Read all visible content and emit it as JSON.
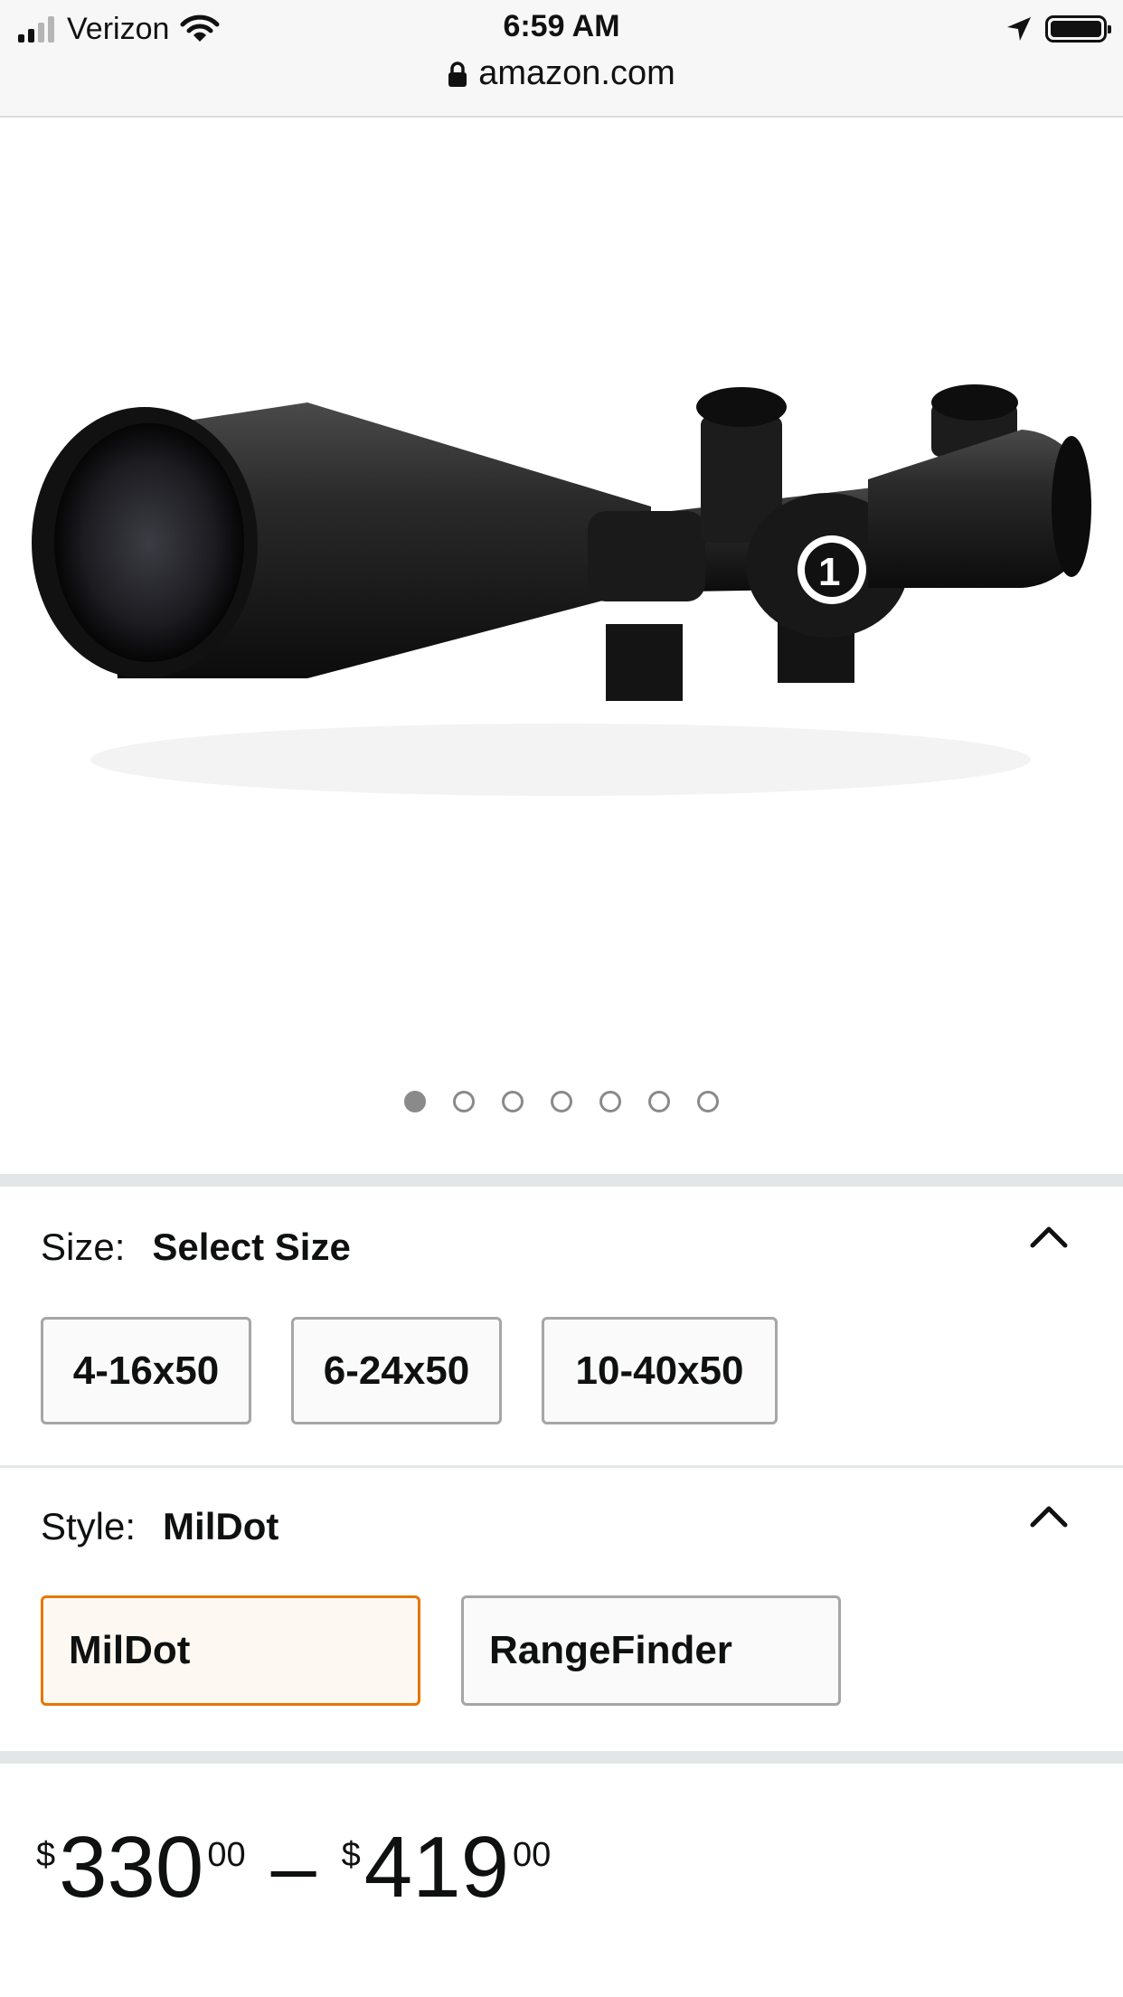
{
  "status_bar": {
    "carrier": "Verizon",
    "time": "6:59 AM",
    "url": "amazon.com",
    "icons": [
      "cellular-signal-icon",
      "wifi-icon",
      "lock-icon",
      "location-arrow-icon",
      "battery-icon"
    ]
  },
  "product": {
    "image": {
      "subject": "rifle-scope"
    },
    "carousel": {
      "total": 7,
      "active_index": 0
    }
  },
  "size": {
    "label": "Size:",
    "value": "Select Size",
    "options": [
      "4-16x50",
      "6-24x50",
      "10-40x50"
    ]
  },
  "style": {
    "label": "Style:",
    "value": "MilDot",
    "options": [
      "MilDot",
      "RangeFinder"
    ],
    "selected_index": 0
  },
  "price": {
    "low": {
      "currency": "$",
      "whole": "330",
      "fraction": "00"
    },
    "separator": "–",
    "high": {
      "currency": "$",
      "whole": "419",
      "fraction": "00"
    }
  },
  "colors": {
    "selected_border": "#e77600",
    "selected_fill": "#fef8f2",
    "option_border": "#a6a6a6",
    "divider": "#e3e6e6",
    "status_bar_bg": "#f7f7f7"
  }
}
